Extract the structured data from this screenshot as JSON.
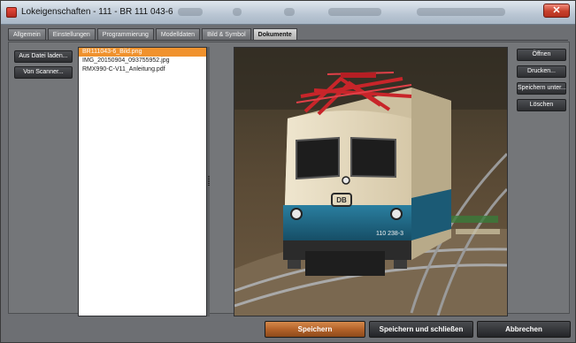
{
  "window": {
    "title": "Lokeigenschaften - 111 - BR 111 043-6",
    "close_label": "✕"
  },
  "tabs": [
    {
      "label": "Allgemein",
      "active": false
    },
    {
      "label": "Einstellungen",
      "active": false
    },
    {
      "label": "Programmierung",
      "active": false
    },
    {
      "label": "Modelldaten",
      "active": false
    },
    {
      "label": "Bild & Symbol",
      "active": false
    },
    {
      "label": "Dokumente",
      "active": true
    }
  ],
  "left_buttons": {
    "load_file": "Aus Datei laden...",
    "from_scanner": "Von Scanner..."
  },
  "files": [
    {
      "name": "BR111043-6_Bild.png",
      "selected": true
    },
    {
      "name": "IMG_20150904_093755952.jpg",
      "selected": false
    },
    {
      "name": "RMX990-C-V11_Anleitung.pdf",
      "selected": false
    }
  ],
  "right_buttons": {
    "open": "Öffnen",
    "print": "Drucken...",
    "save_as": "Speichern unter...",
    "delete": "Löschen"
  },
  "preview": {
    "loco_number": "110 238-3",
    "logo_text": "DB"
  },
  "bottom_buttons": {
    "save": "Speichern",
    "save_close": "Speichern und schließen",
    "cancel": "Abbrechen"
  },
  "colors": {
    "accent_orange": "#f0922e",
    "panel_bg": "#747679",
    "loco_cream": "#e8dcc0",
    "loco_blue": "#1f6d8a",
    "pantograph_red": "#c8252a"
  }
}
